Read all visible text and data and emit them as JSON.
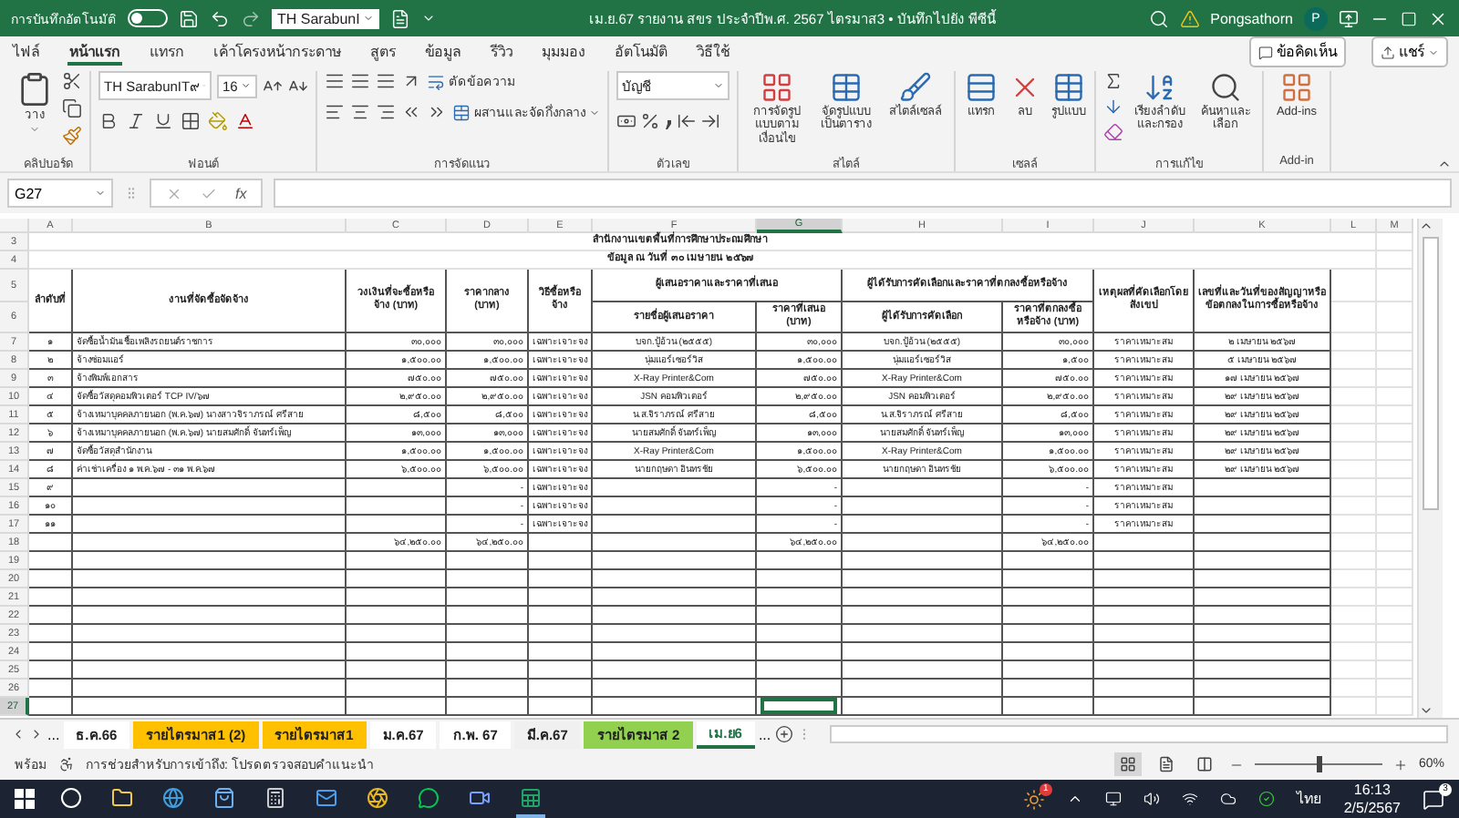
{
  "title_bar": {
    "autosave_label": "การบันทึกอัตโนมัติ",
    "autosave_on": false,
    "font_box": "TH SarabunI",
    "title": "เม.ย.67 รายงาน สขร ประจำปีพ.ศ. 2567 ไตรมาส3 • บันทึกไปยัง พีซีนี้",
    "user": "Pongsathorn",
    "avatar": "P"
  },
  "ribbon_tabs": [
    {
      "label": "ไฟล์",
      "selected": false
    },
    {
      "label": "หน้าแรก",
      "selected": true
    },
    {
      "label": "แทรก",
      "selected": false
    },
    {
      "label": "เค้าโครงหน้ากระดาษ",
      "selected": false
    },
    {
      "label": "สูตร",
      "selected": false
    },
    {
      "label": "ข้อมูล",
      "selected": false
    },
    {
      "label": "รีวิว",
      "selected": false
    },
    {
      "label": "มุมมอง",
      "selected": false
    },
    {
      "label": "อัตโนมัติ",
      "selected": false
    },
    {
      "label": "วิธีใช้",
      "selected": false
    }
  ],
  "comments_button": "ข้อคิดเห็น",
  "share_button": "แชร์",
  "ribbon_groups": [
    {
      "kind": "clipboard",
      "label": "คลิปบอร์ด",
      "paste": "วาง"
    },
    {
      "kind": "font",
      "label": "ฟอนต์",
      "font": "TH SarabunIT๙",
      "size": "16"
    },
    {
      "kind": "alignment",
      "label": "การจัดแนว",
      "wrap": "ตัดข้อความ",
      "merge": "ผสานและจัดกึ่งกลาง"
    },
    {
      "kind": "number",
      "label": "ตัวเลข",
      "format": "บัญชี"
    },
    {
      "kind": "buttons",
      "label": "สไตล์",
      "buttons": [
        "การจัดรูปแบบตามเงื่อนไข",
        "จัดรูปแบบเป็นตาราง",
        "สไตล์เซลล์"
      ]
    },
    {
      "kind": "buttons",
      "label": "เซลล์",
      "buttons": [
        "แทรก",
        "ลบ",
        "รูปแบบ"
      ]
    },
    {
      "kind": "editing",
      "label": "การแก้ไข",
      "buttons": [
        "เรียงลำดับและกรอง",
        "ค้นหาและเลือก"
      ]
    },
    {
      "kind": "buttons",
      "label": "Add-in",
      "buttons": [
        "Add-ins"
      ]
    }
  ],
  "formula_bar": {
    "name_box": "G27",
    "function_label": "fx"
  },
  "sheet": {
    "columns": [
      {
        "label": "A",
        "selected": false
      },
      {
        "label": "B",
        "selected": false
      },
      {
        "label": "C",
        "selected": false
      },
      {
        "label": "D",
        "selected": false
      },
      {
        "label": "E",
        "selected": false
      },
      {
        "label": "F",
        "selected": false
      },
      {
        "label": "G",
        "selected": true
      },
      {
        "label": "H",
        "selected": false
      },
      {
        "label": "I",
        "selected": false
      },
      {
        "label": "J",
        "selected": false
      },
      {
        "label": "K",
        "selected": false
      },
      {
        "label": "L",
        "selected": false
      },
      {
        "label": "M",
        "selected": false
      }
    ],
    "rows": [
      {
        "number": "3",
        "kind": "title",
        "selected": false,
        "text": "สำนักงานเขตพื้นที่การศึกษาประถมศึกษา"
      },
      {
        "number": "4",
        "kind": "title",
        "selected": false,
        "text": "ข้อมูล ณ วันที่ ๓๐ เมษายน ๒๕๖๗"
      },
      {
        "number": "5",
        "kind": "header_top",
        "selected": false,
        "cells": {
          "A": "ลำดับที่",
          "B": "งานที่จัดซื้อจัดจ้าง",
          "C": "วงเงินที่จะซื้อหรือจ้าง (บาท)",
          "D": "ราคากลาง (บาท)",
          "E": "วิธีซื้อหรือจ้าง",
          "F": "ผู้เสนอราคาและราคาที่เสนอ",
          "H": "ผู้ได้รับการคัดเลือกและราคาที่ตกลงซื้อหรือจ้าง",
          "J": "เหตุผลที่คัดเลือกโดยสังเขป",
          "K": "เลขที่และวันที่ของสัญญาหรือข้อตกลงในการซื้อหรือจ้าง"
        }
      },
      {
        "number": "6",
        "kind": "header_bottom",
        "selected": false,
        "cells": {
          "F": "รายชื่อผู้เสนอราคา",
          "G": "ราคาที่เสนอ (บาท)",
          "H": "ผู้ได้รับการคัดเลือก",
          "I": "ราคาที่ตกลงซื้อหรือจ้าง (บาท)"
        }
      },
      {
        "number": "7",
        "kind": "data",
        "selected": false,
        "cells": {
          "A": "๑",
          "B": "จัดซื้อน้ำมันเชื้อเพลิงรถยนต์ราชการ",
          "C": "๓๐,๐๐๐",
          "D": "๓๐,๐๐๐",
          "E": "เฉพาะเจาะจง",
          "F": "บจก.ปู้อ้วน (๒๕๕๕)",
          "G": "๓๐,๐๐๐",
          "H": "บจก.ปู้อ้วน (๒๕๕๕)",
          "I": "๓๐,๐๐๐",
          "J": "ราคาเหมาะสม",
          "K": "๒ เมษายน ๒๕๖๗"
        }
      },
      {
        "number": "8",
        "kind": "data",
        "selected": false,
        "cells": {
          "A": "๒",
          "B": "จ้างซ่อมแอร์",
          "C": "๑,๕๐๐.๐๐",
          "D": "๑,๕๐๐.๐๐",
          "E": "เฉพาะเจาะจง",
          "F": "นุ่มแอร์เซอร์วิส",
          "G": "๑,๕๐๐.๐๐",
          "H": "นุ่มแอร์เซอร์วิส",
          "I": "๑,๕๐๐",
          "J": "ราคาเหมาะสม",
          "K": "๕ เมษายน ๒๕๖๗"
        }
      },
      {
        "number": "9",
        "kind": "data",
        "selected": false,
        "cells": {
          "A": "๓",
          "B": "จ้างพิมพ์เอกสาร",
          "C": "๗๕๐.๐๐",
          "D": "๗๕๐.๐๐",
          "E": "เฉพาะเจาะจง",
          "F": "X-Ray Printer&Com",
          "G": "๗๕๐.๐๐",
          "H": "X-Ray Printer&Com",
          "I": "๗๕๐.๐๐",
          "J": "ราคาเหมาะสม",
          "K": "๑๗ เมษายน ๒๕๖๗"
        }
      },
      {
        "number": "10",
        "kind": "data",
        "selected": false,
        "cells": {
          "A": "๔",
          "B": "จัดซื้อวัสดุคอมพิวเตอร์ TCP IV/๖๗",
          "C": "๒,๙๕๐.๐๐",
          "D": "๒,๙๕๐.๐๐",
          "E": "เฉพาะเจาะจง",
          "F": "JSN คอมพิวเตอร์",
          "G": "๒,๙๕๐.๐๐",
          "H": "JSN คอมพิวเตอร์",
          "I": "๒,๙๕๐.๐๐",
          "J": "ราคาเหมาะสม",
          "K": "๒๙ เมษายน ๒๕๖๗"
        }
      },
      {
        "number": "11",
        "kind": "data",
        "selected": false,
        "cells": {
          "A": "๕",
          "B": "จ้างเหมาบุคคลภายนอก (พ.ค.๖๗) นางสาวจิราภรณ์ ศรีสาย",
          "C": "๘,๕๐๐",
          "D": "๘,๕๐๐",
          "E": "เฉพาะเจาะจง",
          "F": "น.ส.จิราภรณ์ ศรีสาย",
          "G": "๘,๕๐๐",
          "H": "น.ส.จิราภรณ์ ศรีสาย",
          "I": "๘,๕๐๐",
          "J": "ราคาเหมาะสม",
          "K": "๒๙ เมษายน ๒๕๖๗"
        }
      },
      {
        "number": "12",
        "kind": "data",
        "selected": false,
        "cells": {
          "A": "๖",
          "B": "จ้างเหมาบุคคลภายนอก (พ.ค.๖๗) นายสมศักดิ์ จันทร์เพ็ญ",
          "C": "๑๓,๐๐๐",
          "D": "๑๓,๐๐๐",
          "E": "เฉพาะเจาะจง",
          "F": "นายสมศักดิ์ จันทร์เพ็ญ",
          "G": "๑๓,๐๐๐",
          "H": "นายสมศักดิ์ จันทร์เพ็ญ",
          "I": "๑๓,๐๐๐",
          "J": "ราคาเหมาะสม",
          "K": "๒๙ เมษายน ๒๕๖๗"
        }
      },
      {
        "number": "13",
        "kind": "data",
        "selected": false,
        "cells": {
          "A": "๗",
          "B": "จัดซื้อวัสดุสำนักงาน",
          "C": "๑,๕๐๐.๐๐",
          "D": "๑,๕๐๐.๐๐",
          "E": "เฉพาะเจาะจง",
          "F": "X-Ray Printer&Com",
          "G": "๑,๕๐๐.๐๐",
          "H": "X-Ray Printer&Com",
          "I": "๑,๕๐๐.๐๐",
          "J": "ราคาเหมาะสม",
          "K": "๒๙ เมษายน ๒๕๖๗"
        }
      },
      {
        "number": "14",
        "kind": "data",
        "selected": false,
        "cells": {
          "A": "๘",
          "B": "ค่าเช่าเครื่อง ๑ พ.ค.๖๗ - ๓๑ พ.ค.๖๗",
          "C": "๖,๕๐๐.๐๐",
          "D": "๖,๕๐๐.๐๐",
          "E": "เฉพาะเจาะจง",
          "F": "นายกฤษดา อินทรชัย",
          "G": "๖,๕๐๐.๐๐",
          "H": "นายกฤษดา อินทรชัย",
          "I": "๖,๕๐๐.๐๐",
          "J": "ราคาเหมาะสม",
          "K": "๒๙ เมษายน ๒๕๖๗"
        }
      },
      {
        "number": "15",
        "kind": "data",
        "selected": false,
        "cells": {
          "A": "๙",
          "D": "-",
          "E": "เฉพาะเจาะจง",
          "G": "-",
          "I": "-",
          "J": "ราคาเหมาะสม"
        }
      },
      {
        "number": "16",
        "kind": "data",
        "selected": false,
        "cells": {
          "A": "๑๐",
          "D": "-",
          "E": "เฉพาะเจาะจง",
          "G": "-",
          "I": "-",
          "J": "ราคาเหมาะสม"
        }
      },
      {
        "number": "17",
        "kind": "data",
        "selected": false,
        "cells": {
          "A": "๑๑",
          "D": "-",
          "E": "เฉพาะเจาะจง",
          "G": "-",
          "I": "-",
          "J": "ราคาเหมาะสม"
        }
      },
      {
        "number": "18",
        "kind": "total",
        "selected": false,
        "cells": {
          "C": "๖๔,๒๕๐.๐๐",
          "D": "๖๔,๒๕๐.๐๐",
          "G": "๖๔,๒๕๐.๐๐",
          "I": "๖๔,๒๕๐.๐๐"
        }
      },
      {
        "number": "19",
        "kind": "data",
        "selected": false
      },
      {
        "number": "20",
        "kind": "data",
        "selected": false
      },
      {
        "number": "21",
        "kind": "data",
        "selected": false
      },
      {
        "number": "22",
        "kind": "data",
        "selected": false
      },
      {
        "number": "23",
        "kind": "data",
        "selected": false
      },
      {
        "number": "24",
        "kind": "data",
        "selected": false
      },
      {
        "number": "25",
        "kind": "data",
        "selected": false
      },
      {
        "number": "26",
        "kind": "data",
        "selected": false
      },
      {
        "number": "27",
        "kind": "data",
        "selected": true
      }
    ]
  },
  "sheet_nav": {
    "more_left": "...",
    "more_right": "..."
  },
  "sheet_tabs": [
    {
      "label": "ธ.ค.66",
      "color": "#ffffff",
      "selected": false
    },
    {
      "label": "รายไตรมาส1 (2)",
      "color": "#ffc000",
      "selected": false
    },
    {
      "label": "รายไตรมาส1",
      "color": "#ffc000",
      "selected": false
    },
    {
      "label": "ม.ค.67",
      "color": "#ffffff",
      "selected": false
    },
    {
      "label": "ก.พ. 67",
      "color": "#ffffff",
      "selected": false
    },
    {
      "label": "มี.ค.67",
      "color": "#f0f0f0",
      "selected": false
    },
    {
      "label": "รายไตรมาส 2",
      "color": "#92d050",
      "selected": false
    },
    {
      "label": "เม.ย6",
      "color": "#ffffff",
      "selected": true
    }
  ],
  "status_bar": {
    "status": "พร้อม",
    "accessibility": "การช่วยสำหรับการเข้าถึง: โปรดตรวจสอบคำแนะนำ",
    "views": [
      {
        "kind": "normal",
        "selected": true
      },
      {
        "kind": "page_layout",
        "selected": false
      },
      {
        "kind": "page_break",
        "selected": false
      }
    ],
    "zoom": {
      "level": 0.5,
      "reading": "60%"
    }
  },
  "taskbar": {
    "apps": [
      {
        "kind": "search",
        "active": false
      },
      {
        "kind": "folder",
        "active": false
      },
      {
        "kind": "browser",
        "active": false
      },
      {
        "kind": "store",
        "active": false
      },
      {
        "kind": "calculator",
        "active": false
      },
      {
        "kind": "mail",
        "active": false
      },
      {
        "kind": "chrome",
        "active": false
      },
      {
        "kind": "chat",
        "active": false
      },
      {
        "kind": "meeting",
        "active": false
      },
      {
        "kind": "spreadsheet",
        "active": true
      }
    ],
    "weather_badge": "1",
    "language": "ไทย",
    "time": "16:13",
    "date": "2/5/2567",
    "notifications": "3"
  }
}
